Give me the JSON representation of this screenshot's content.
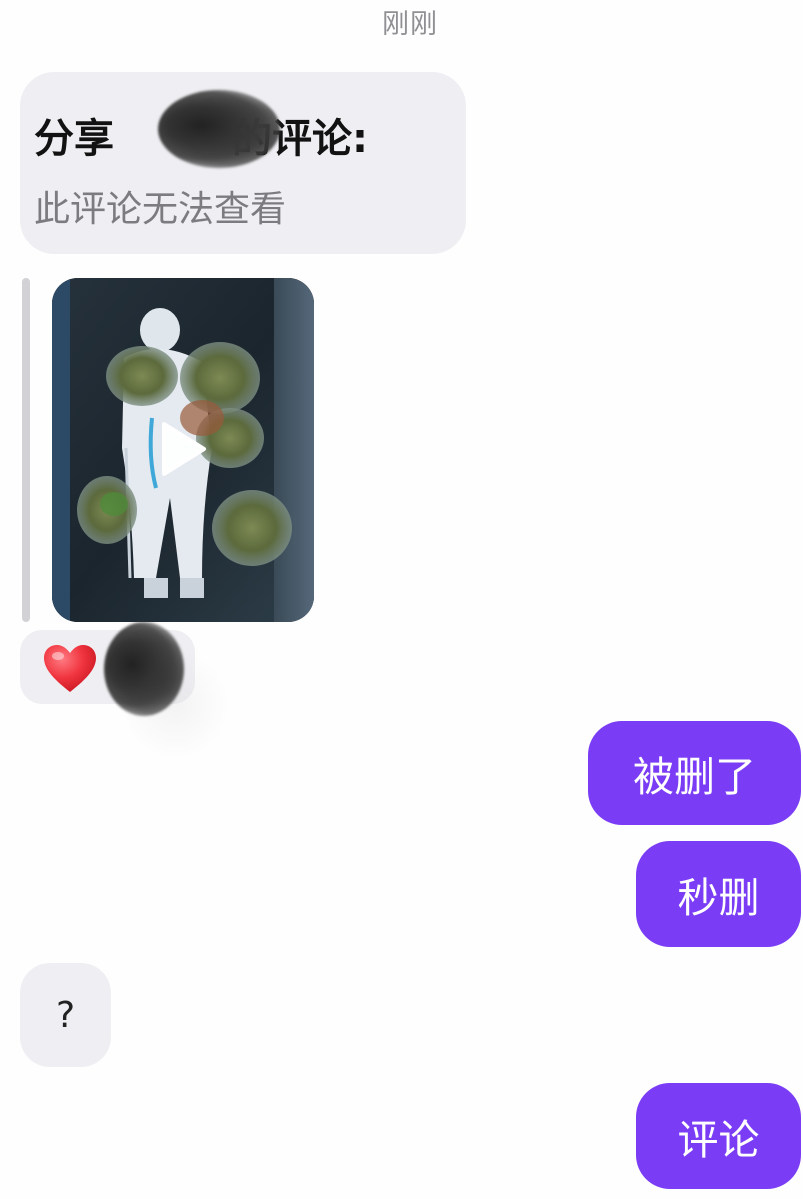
{
  "chat": {
    "timestamp": "刚刚",
    "shared_card": {
      "title_prefix": "分享",
      "title_suffix": "的评论:",
      "subtitle": "此评论无法查看"
    },
    "video_attachment": {
      "play_icon": "play-icon"
    },
    "reaction": {
      "emoji_icon": "heart-icon",
      "color": "#f0353f"
    },
    "messages": [
      {
        "side": "outgoing",
        "text": "被删了"
      },
      {
        "side": "outgoing",
        "text": "秒删"
      },
      {
        "side": "incoming",
        "text": "?"
      },
      {
        "side": "outgoing",
        "text": "评论"
      }
    ]
  },
  "colors": {
    "outgoing_bubble": "#7a3cf5",
    "incoming_bubble": "#efeff3",
    "background": "#fefefe",
    "timestamp_text": "#8f8f94"
  }
}
